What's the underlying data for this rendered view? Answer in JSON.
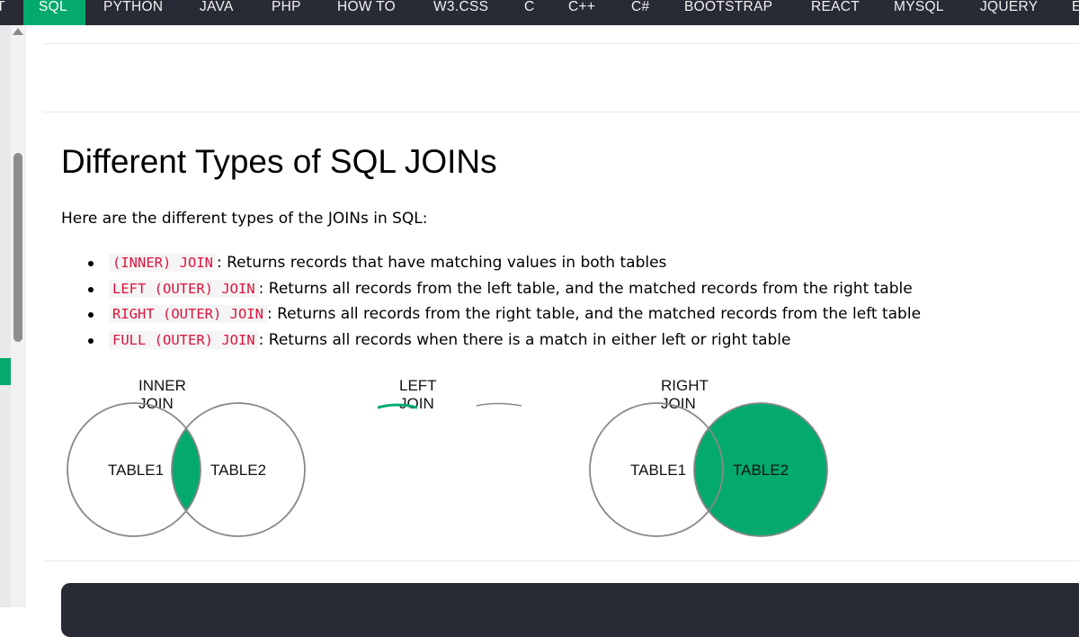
{
  "nav": {
    "items": [
      {
        "label": "T"
      },
      {
        "label": "SQL",
        "active": true
      },
      {
        "label": "PYTHON"
      },
      {
        "label": "JAVA"
      },
      {
        "label": "PHP"
      },
      {
        "label": "HOW TO"
      },
      {
        "label": "W3.CSS"
      },
      {
        "label": "C"
      },
      {
        "label": "C++"
      },
      {
        "label": "C#"
      },
      {
        "label": "BOOTSTRAP"
      },
      {
        "label": "REACT"
      },
      {
        "label": "MYSQL"
      },
      {
        "label": "JQUERY"
      },
      {
        "label": "E"
      }
    ]
  },
  "main": {
    "title": "Different Types of SQL JOINs",
    "intro": "Here are the different types of the JOINs in SQL:",
    "joins": [
      {
        "code": "(INNER) JOIN",
        "desc": ": Returns records that have matching values in both tables"
      },
      {
        "code": "LEFT (OUTER) JOIN",
        "desc": ": Returns all records from the left table, and the matched records from the right table"
      },
      {
        "code": "RIGHT (OUTER) JOIN",
        "desc": ": Returns all records from the right table, and the matched records from the left table"
      },
      {
        "code": "FULL (OUTER) JOIN",
        "desc": ": Returns all records when there is a match in either left or right table"
      }
    ]
  },
  "diagrams": {
    "inner": {
      "title": "INNER JOIN",
      "left": "TABLE1",
      "right": "TABLE2"
    },
    "left": {
      "title": "LEFT JOIN"
    },
    "right": {
      "title": "RIGHT JOIN",
      "left": "TABLE1",
      "right": "TABLE2"
    }
  },
  "colors": {
    "nav_bg": "#282a35",
    "accent": "#04aa6d",
    "code_text": "#dc143c"
  }
}
